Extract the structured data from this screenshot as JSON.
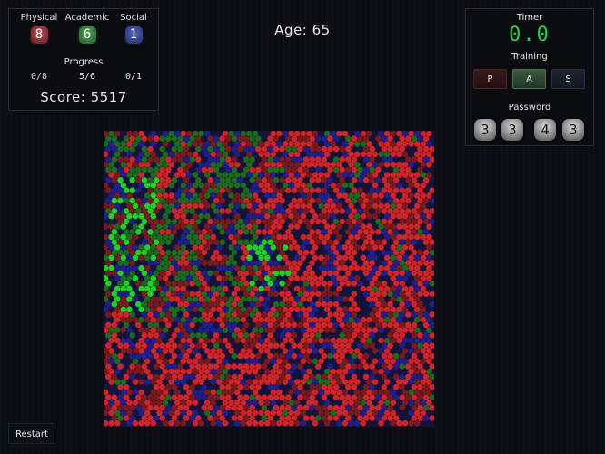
{
  "stats": [
    {
      "name": "Physical",
      "value": "8",
      "progress": "0/8"
    },
    {
      "name": "Academic",
      "value": "6",
      "progress": "5/6"
    },
    {
      "name": "Social",
      "value": "1",
      "progress": "0/1"
    }
  ],
  "progress_label": "Progress",
  "score": "Score: 5517",
  "age": "Age: 65",
  "timer": {
    "label": "Timer",
    "value": "0.0"
  },
  "training": {
    "label": "Training",
    "buttons": [
      "P",
      "A",
      "S"
    ]
  },
  "password": {
    "label": "Password",
    "digits": [
      "3",
      "3",
      "4",
      "3"
    ]
  },
  "restart_label": "Restart",
  "colors": {
    "physical": "#b84a55",
    "academic": "#52a45b",
    "social": "#4f63b8",
    "timer": "#22d34a",
    "tile_red": "#d22424",
    "tile_dark_red": "#7a1a1a",
    "tile_green": "#1fd21f",
    "tile_dark_green": "#1d6a1d",
    "tile_blue": "#1e1e8c"
  }
}
